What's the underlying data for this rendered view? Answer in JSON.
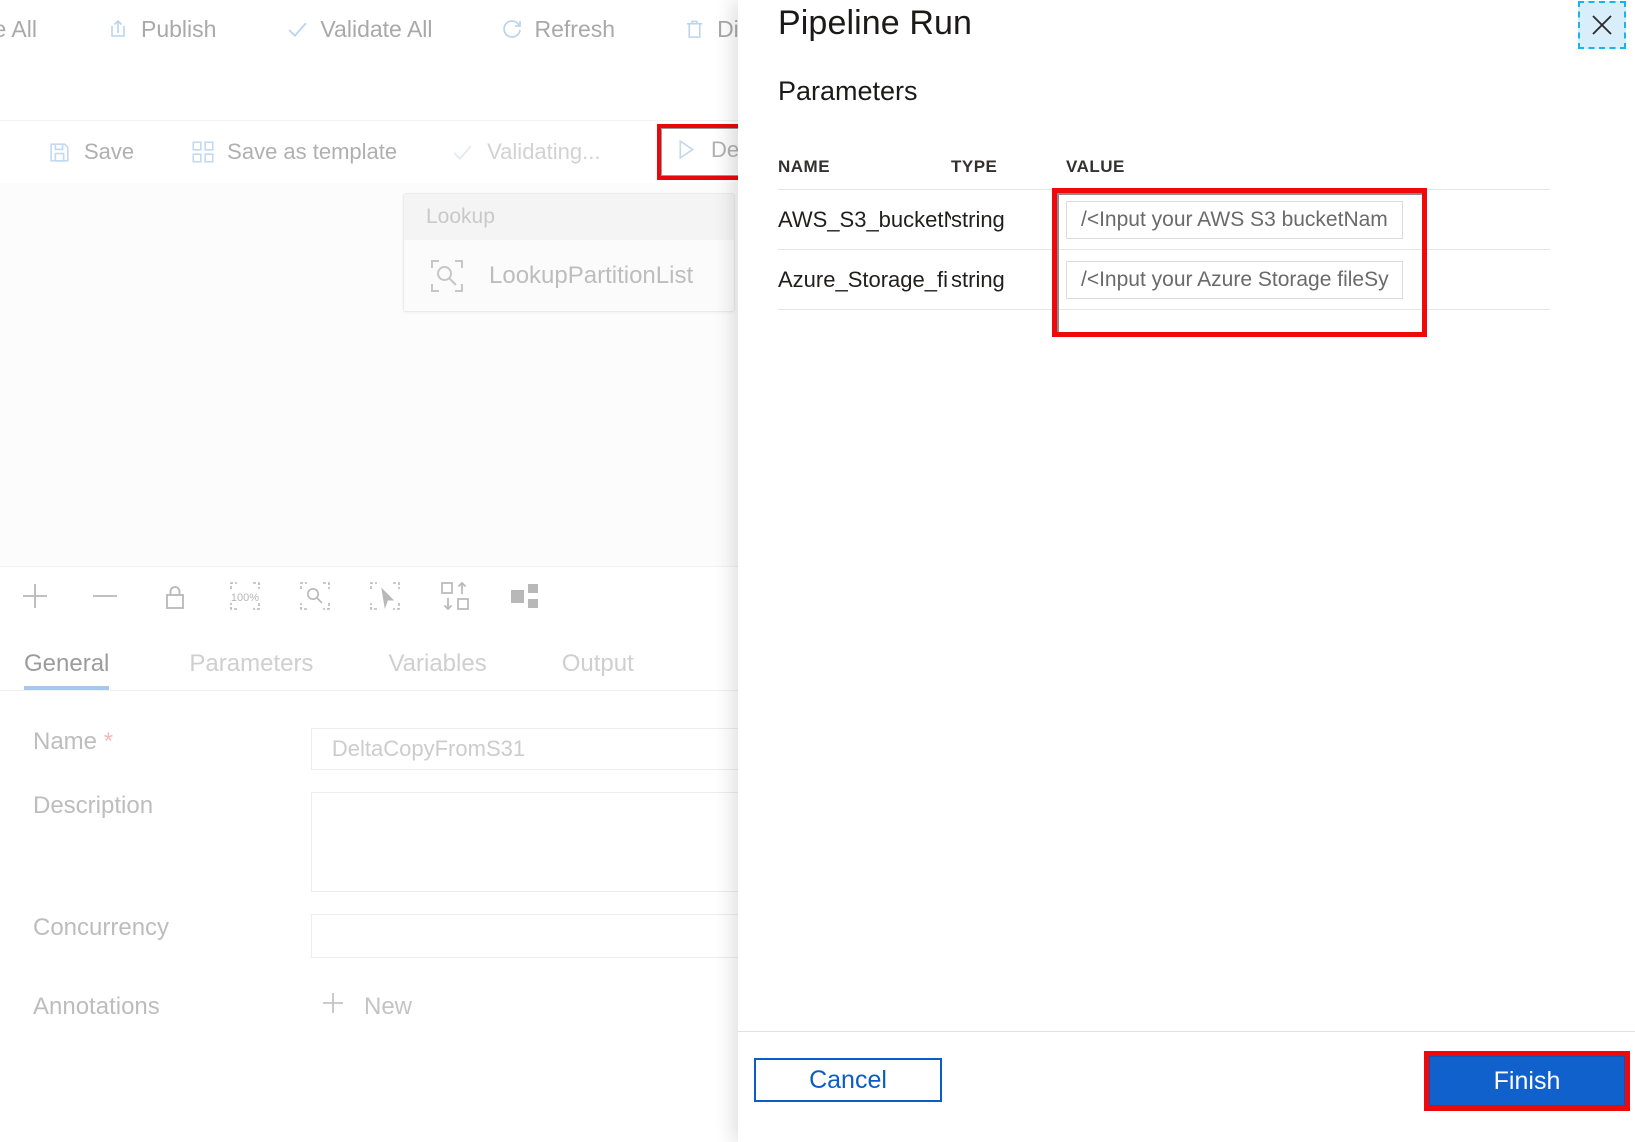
{
  "factory_toolbar": {
    "items": [
      {
        "label": "ve All",
        "icon": "save-all-icon",
        "truncated": true
      },
      {
        "label": "Publish",
        "icon": "publish-upload-icon"
      },
      {
        "label": "Validate All",
        "icon": "checkmark-icon"
      },
      {
        "label": "Refresh",
        "icon": "refresh-icon"
      },
      {
        "label": "Discard",
        "icon": "trash-icon"
      }
    ]
  },
  "pipeline_toolbar": {
    "items": [
      {
        "label": "Save",
        "icon": "save-floppy-icon"
      },
      {
        "label": "Save as template",
        "icon": "template-icon"
      },
      {
        "label": "Validating...",
        "icon": "checkmark-icon",
        "state": "disabled"
      }
    ],
    "debug": {
      "label": "De",
      "icon": "play-triangle-icon",
      "highlighted": true
    }
  },
  "canvas": {
    "activity": {
      "group_label": "Lookup",
      "name": "LookupPartitionList",
      "icon": "lookup-magnifier-icon"
    },
    "zoom_tools": [
      {
        "name": "zoom-in-button",
        "icon": "plus-icon"
      },
      {
        "name": "zoom-out-button",
        "icon": "minus-icon"
      },
      {
        "name": "lock-canvas-button",
        "icon": "lock-icon"
      },
      {
        "name": "zoom-100-button",
        "icon": "zoom-100-icon",
        "label": "100%"
      },
      {
        "name": "zoom-to-fit-button",
        "icon": "zoom-fit-magnifier-icon"
      },
      {
        "name": "select-tool-button",
        "icon": "marquee-cursor-icon"
      },
      {
        "name": "auto-align-button",
        "icon": "auto-align-icon"
      },
      {
        "name": "layout-button",
        "icon": "layout-blocks-icon"
      }
    ]
  },
  "properties": {
    "tabs": [
      {
        "label": "General",
        "active": true
      },
      {
        "label": "Parameters",
        "active": false
      },
      {
        "label": "Variables",
        "active": false
      },
      {
        "label": "Output",
        "active": false
      }
    ],
    "fields": {
      "name_label": "Name",
      "name_required_mark": "*",
      "name_value": "DeltaCopyFromS31",
      "description_label": "Description",
      "description_value": "",
      "concurrency_label": "Concurrency",
      "concurrency_value": "",
      "annotations_label": "Annotations",
      "annotations_new_label": "New",
      "annotations_new_icon": "plus-icon"
    }
  },
  "flyout": {
    "title": "Pipeline Run",
    "close_icon": "close-x-icon",
    "section_title": "Parameters",
    "table": {
      "headers": [
        "NAME",
        "TYPE",
        "VALUE"
      ],
      "rows": [
        {
          "name": "AWS_S3_bucketN",
          "type": "string",
          "value": "/<Input your AWS S3 bucketNam"
        },
        {
          "name": "Azure_Storage_fi",
          "type": "string",
          "value": "/<Input your Azure Storage fileSy"
        }
      ]
    },
    "footer": {
      "cancel_label": "Cancel",
      "finish_label": "Finish"
    }
  },
  "colors": {
    "highlight_red": "#ee0a0a",
    "primary_blue": "#1161cd",
    "cancel_blue": "#0b5cc4",
    "focus_cyan": "#16b5f0",
    "tab_underline": "#a5c8ec"
  }
}
